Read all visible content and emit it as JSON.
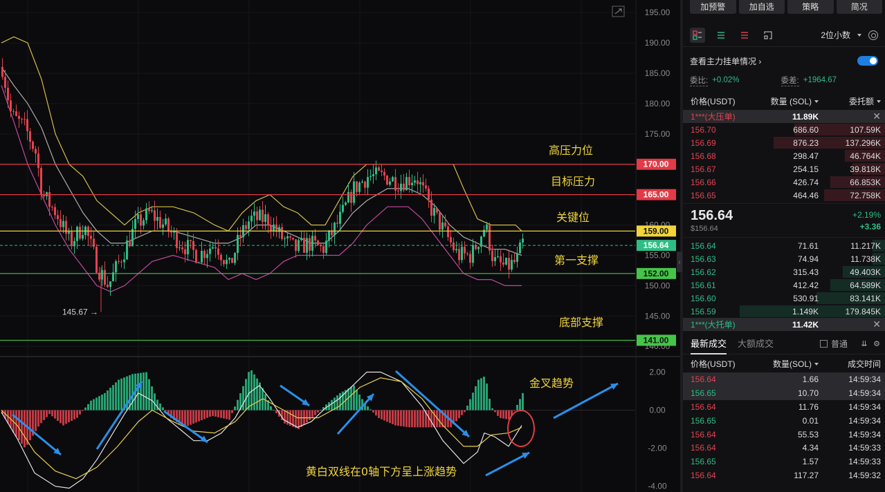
{
  "chart_data": {
    "type": "candlestick",
    "price_axis": {
      "ticks": [
        "195.00",
        "190.00",
        "185.00",
        "180.00",
        "175.00",
        "170.00",
        "165.00",
        "160.00",
        "155.00",
        "150.00",
        "145.00",
        "140.00"
      ],
      "ylim": [
        139,
        196.5
      ]
    },
    "macd_axis": {
      "ticks": [
        "2.00",
        "0.00",
        "-2.00",
        "-4.00"
      ],
      "ylim": [
        -4.3,
        2.6
      ]
    },
    "levels": [
      {
        "price": 170,
        "label": "170.00",
        "note": "高压力位",
        "color": "#e13b47"
      },
      {
        "price": 165,
        "label": "165.00",
        "note": "目标压力",
        "color": "#e13b47"
      },
      {
        "price": 159,
        "label": "159.00",
        "note": "关键位",
        "color": "#f0d43a"
      },
      {
        "price": 152,
        "label": "152.00",
        "note": "第一支撑",
        "color": "#46c44a"
      },
      {
        "price": 141,
        "label": "141.00",
        "note": "底部支撑",
        "color": "#46c44a"
      }
    ],
    "current_price": {
      "price": 156.64,
      "label": "156.64",
      "color": "#2ebd85"
    },
    "low_marker": {
      "price": 145.67,
      "label": "145.67 →"
    },
    "macd_annotations": {
      "golden_cross": "金叉趋势",
      "note": "黄白双线在0轴下方呈上涨趋势"
    },
    "colors": {
      "up": "#2ebd85",
      "down": "#e2434f",
      "bb_upper": "#e8d14a",
      "bb_mid": "#bfbfbf",
      "bb_lower": "#d84fb0",
      "annotation": "#f0d43a",
      "arrow": "#2a8fe8"
    }
  },
  "panel": {
    "buttons": [
      "加预警",
      "加自选",
      "策略",
      "简况"
    ],
    "decimal": "2位小数",
    "orders_link": "查看主力挂单情况",
    "ratio_label": "委比:",
    "ratio_value": "+0.02%",
    "diff_label": "委差:",
    "diff_value": "+1964.67",
    "ob_header": {
      "price": "价格(USDT)",
      "qty": "数量 (SOL)",
      "total": "委托额"
    },
    "ask_wall": {
      "price": "1***(大压单)",
      "qty": "11.89K",
      "close": "✕"
    },
    "asks": [
      {
        "price": "156.70",
        "qty": "686.60",
        "total": "107.59K",
        "depth": 0.45
      },
      {
        "price": "156.69",
        "qty": "876.23",
        "total": "137.296K",
        "depth": 0.55
      },
      {
        "price": "156.68",
        "qty": "298.47",
        "total": "46.764K",
        "depth": 0.2
      },
      {
        "price": "156.67",
        "qty": "254.15",
        "total": "39.818K",
        "depth": 0.16
      },
      {
        "price": "156.66",
        "qty": "426.74",
        "total": "66.853K",
        "depth": 0.27
      },
      {
        "price": "156.65",
        "qty": "464.46",
        "total": "72.758K",
        "depth": 0.3
      }
    ],
    "mid": {
      "price": "156.64",
      "sub": "$156.64",
      "pct": "+2.19%",
      "abs": "+3.36"
    },
    "bids": [
      {
        "price": "156.64",
        "qty": "71.61",
        "total": "11.217K",
        "depth": 0.06
      },
      {
        "price": "156.63",
        "qty": "74.94",
        "total": "11.738K",
        "depth": 0.06
      },
      {
        "price": "156.62",
        "qty": "315.43",
        "total": "49.403K",
        "depth": 0.21
      },
      {
        "price": "156.61",
        "qty": "412.42",
        "total": "64.589K",
        "depth": 0.27
      },
      {
        "price": "156.60",
        "qty": "530.91",
        "total": "83.141K",
        "depth": 0.34
      },
      {
        "price": "156.59",
        "qty": "1.149K",
        "total": "179.845K",
        "depth": 0.72
      }
    ],
    "bid_wall": {
      "price": "1***(大托单)",
      "qty": "11.42K",
      "close": "✕"
    },
    "trades_tabs": [
      "最新成交",
      "大额成交"
    ],
    "trades_filter": "普通",
    "tr_header": {
      "price": "价格(USDT)",
      "qty": "数量(SOL)",
      "time": "成交时间"
    },
    "trades": [
      {
        "price": "156.64",
        "qty": "1.66",
        "time": "14:59:34",
        "side": "sell"
      },
      {
        "price": "156.65",
        "qty": "10.70",
        "time": "14:59:34",
        "side": "buy"
      },
      {
        "price": "156.64",
        "qty": "11.76",
        "time": "14:59:34",
        "side": "sell"
      },
      {
        "price": "156.65",
        "qty": "0.01",
        "time": "14:59:34",
        "side": "buy"
      },
      {
        "price": "156.64",
        "qty": "55.53",
        "time": "14:59:34",
        "side": "sell"
      },
      {
        "price": "156.64",
        "qty": "4.34",
        "time": "14:59:33",
        "side": "sell"
      },
      {
        "price": "156.65",
        "qty": "1.57",
        "time": "14:59:33",
        "side": "buy"
      },
      {
        "price": "156.64",
        "qty": "117.27",
        "time": "14:59:32",
        "side": "sell"
      }
    ]
  }
}
